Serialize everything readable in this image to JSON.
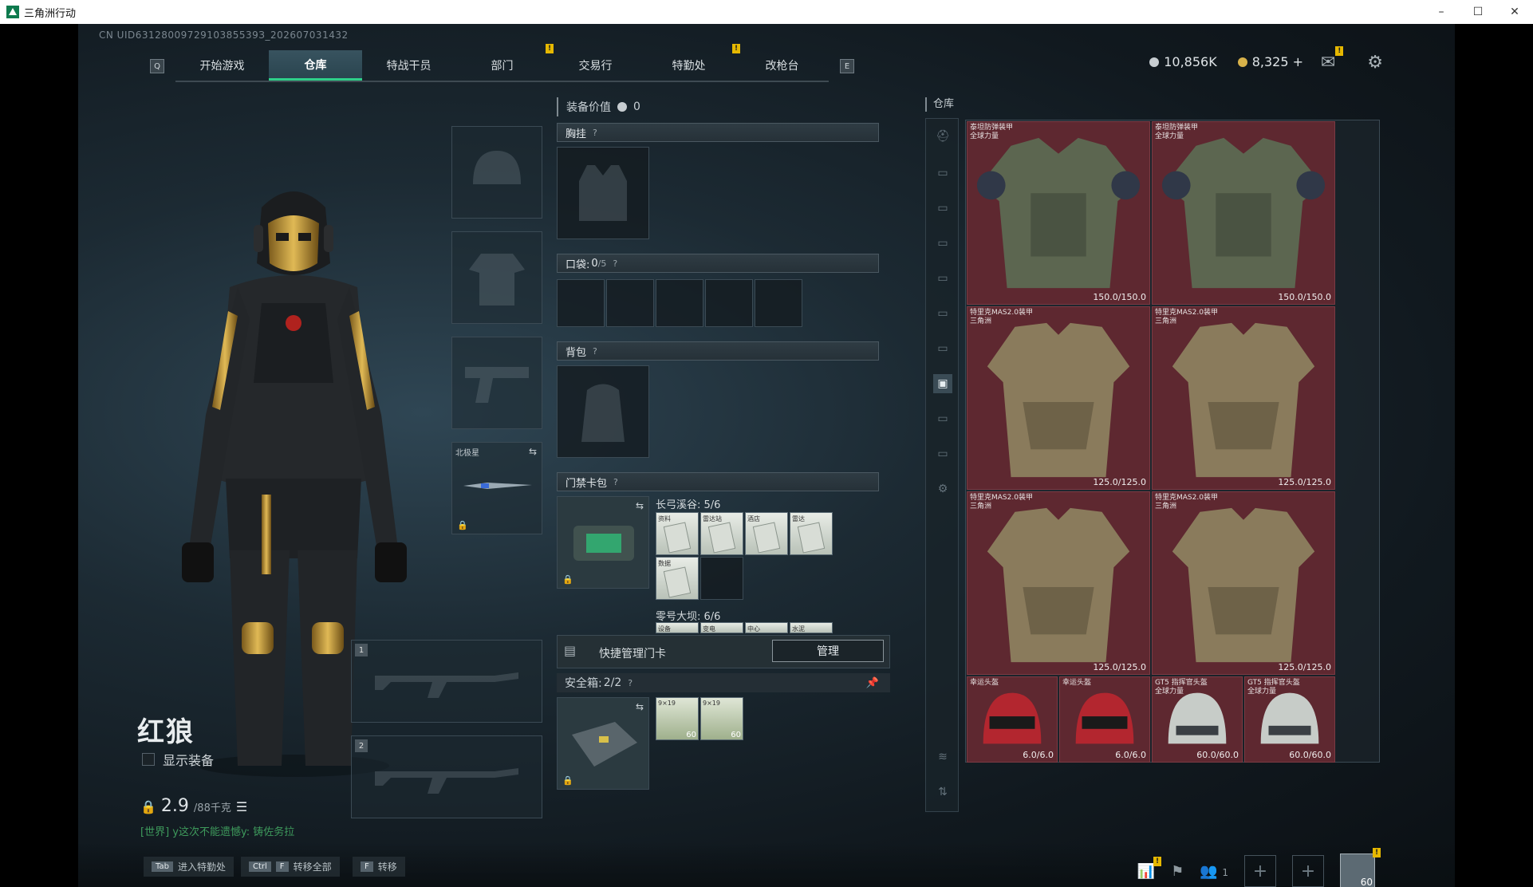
{
  "window": {
    "title": "三角洲行动",
    "minimize": "–",
    "maximize": "☐",
    "close": "✕"
  },
  "uid": "CN UID6312800972910385539З_202607031432",
  "nav": {
    "key_left": "Q",
    "key_right": "E",
    "tabs": [
      {
        "label": "开始游戏",
        "active": false
      },
      {
        "label": "仓库",
        "active": true
      },
      {
        "label": "特战干员",
        "active": false
      },
      {
        "label": "部门",
        "active": false
      },
      {
        "label": "交易行",
        "active": false,
        "badge": "!"
      },
      {
        "label": "特勤处",
        "active": false
      },
      {
        "label": "改枪台",
        "active": false,
        "badge": "!"
      }
    ]
  },
  "currency": {
    "silver": "10,856K",
    "gold": "8,325",
    "plus": "+",
    "silver_color": "#c7cdd1",
    "gold_color": "#d8b24a"
  },
  "top_badge": "!",
  "operator": {
    "name": "红狼",
    "show_equipment": "显示装备",
    "weight": "2.9",
    "weight_unit": "/88千克",
    "world_chat": "[世界] y这次不能遗憾y: 铸佐务拉"
  },
  "slots": {
    "melee_label": "北极星",
    "weapon1": "1",
    "weapon2": "2"
  },
  "equip": {
    "value_label": "装备价值",
    "value": "0",
    "chest": "胸挂",
    "pockets": "口袋:",
    "pockets_count": "0",
    "pockets_max": "/5",
    "backpack": "背包",
    "keycard_bag": "门禁卡包",
    "help": "?",
    "zone1": "长弓溪谷: 5/6",
    "zone1_cards": [
      "资料",
      "雷达站",
      "酒店",
      "雷达",
      "数据"
    ],
    "zone2": "零号大坝: 6/6",
    "zone2_cards": [
      "设备",
      "变电",
      "中心",
      "水泥"
    ],
    "quick_manage": "快捷管理门卡",
    "manage_btn": "管理",
    "safe_box": "安全箱:",
    "safe_box_count": "2/2",
    "ammo_label": "9×19",
    "ammo_count": "60"
  },
  "storage": {
    "title": "仓库",
    "items": [
      {
        "name": "泰坦防弹装甲\n全球力量",
        "dur": "150.0/150.0",
        "kind": "titan"
      },
      {
        "name": "泰坦防弹装甲\n全球力量",
        "dur": "150.0/150.0",
        "kind": "titan"
      },
      {
        "name": "特里克MAS2.0装甲\n三角洲",
        "dur": "125.0/125.0",
        "kind": "mas"
      },
      {
        "name": "特里克MAS2.0装甲\n三角洲",
        "dur": "125.0/125.0",
        "kind": "mas"
      },
      {
        "name": "特里克MAS2.0装甲\n三角洲",
        "dur": "125.0/125.0",
        "kind": "mas"
      },
      {
        "name": "特里克MAS2.0装甲\n三角洲",
        "dur": "125.0/125.0",
        "kind": "mas"
      },
      {
        "name": "幸运头盔",
        "dur": "6.0/6.0",
        "kind": "lucky"
      },
      {
        "name": "幸运头盔",
        "dur": "6.0/6.0",
        "kind": "lucky"
      },
      {
        "name": "GT5 指挥官头盔\n全球力量",
        "dur": "60.0/60.0",
        "kind": "gt5"
      },
      {
        "name": "GT5 指挥官头盔\n全球力量",
        "dur": "60.0/60.0",
        "kind": "gt5"
      }
    ]
  },
  "bottom": {
    "hint1_key": "Tab",
    "hint1": "进入特勤处",
    "hint2_key1": "Ctrl",
    "hint2_key2": "F",
    "hint2": "转移全部",
    "hint3_key": "F",
    "hint3": "转移",
    "party_count": "1",
    "level": "60",
    "plus": "+"
  }
}
